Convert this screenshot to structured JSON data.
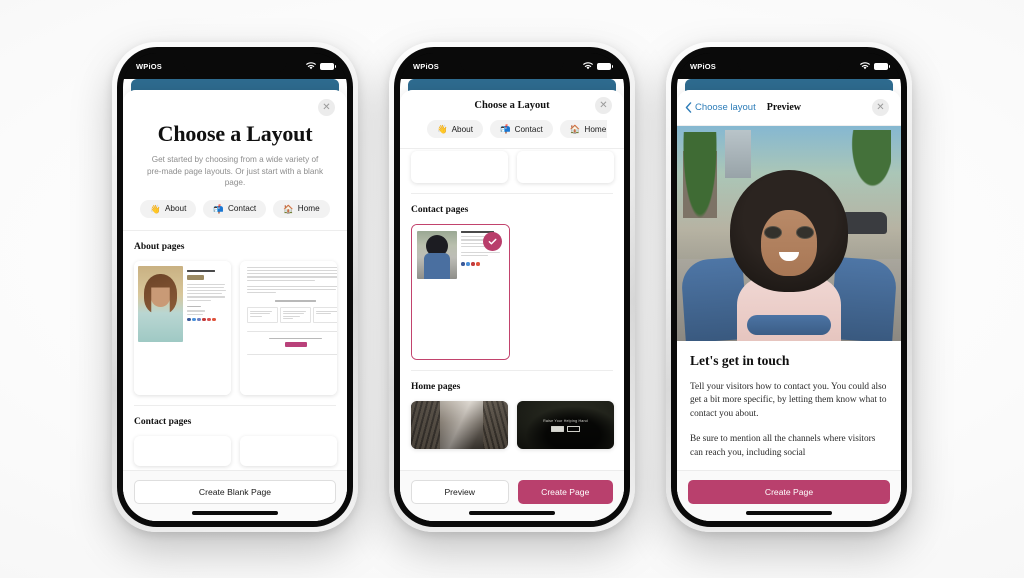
{
  "app": {
    "status_bar": {
      "label": "WPiOS",
      "wifi_icon": "wifi-icon",
      "battery_icon": "battery-icon"
    }
  },
  "phone1": {
    "sheet": {
      "title": "Choose a Layout",
      "subtitle": "Get started by choosing from a wide variety of pre-made page layouts. Or just start with a blank page.",
      "close_label": "✕"
    },
    "chips": [
      {
        "emoji": "👋",
        "label": "About",
        "icon": "waving-hand-icon"
      },
      {
        "emoji": "📬",
        "label": "Contact",
        "icon": "mailbox-icon"
      },
      {
        "emoji": "🏠",
        "label": "Home",
        "icon": "house-icon"
      }
    ],
    "sections": [
      {
        "title": "About pages"
      },
      {
        "title": "Contact pages"
      }
    ],
    "footer": {
      "blank_label": "Create Blank Page"
    }
  },
  "phone2": {
    "sheet": {
      "title": "Choose a Layout",
      "close_label": "✕"
    },
    "chips": [
      {
        "emoji": "👋",
        "label": "About",
        "icon": "waving-hand-icon"
      },
      {
        "emoji": "📬",
        "label": "Contact",
        "icon": "mailbox-icon"
      },
      {
        "emoji": "🏠",
        "label": "Home",
        "icon": "house-icon"
      }
    ],
    "sections": [
      {
        "title": "Contact pages"
      },
      {
        "title": "Home pages"
      }
    ],
    "selected_badge": "checkmark-icon",
    "home_card_title": "Raise Your Helping Hand",
    "footer": {
      "preview_label": "Preview",
      "create_label": "Create Page"
    }
  },
  "phone3": {
    "nav": {
      "back_label": "Choose layout",
      "back_icon": "chevron-left-icon",
      "title": "Preview",
      "close_label": "✕"
    },
    "preview": {
      "heading": "Let's get in touch",
      "paragraph1": "Tell your visitors how to contact you. You could also get a bit more specific, by letting them know what to contact you about.",
      "paragraph2": "Be sure to mention all the channels where visitors can reach you, including social"
    },
    "footer": {
      "create_label": "Create Page"
    }
  },
  "colors": {
    "accent_pink": "#b9406d",
    "link_blue": "#2c7cb8",
    "chip_bg": "#f2f2f2",
    "app_header_blue": "#2e6b8f"
  }
}
